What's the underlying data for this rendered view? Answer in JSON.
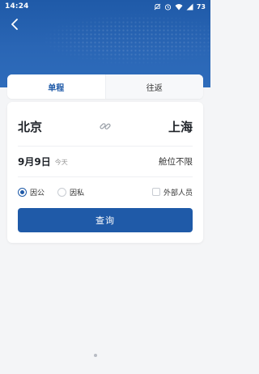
{
  "status_bar": {
    "time": "14:24",
    "battery": "73"
  },
  "tabs": [
    {
      "label": "单程",
      "active": true
    },
    {
      "label": "往返",
      "active": false
    }
  ],
  "route": {
    "from_city": "北京",
    "to_city": "上海"
  },
  "date": {
    "value": "9月9日",
    "note": "今天"
  },
  "cabin": "舱位不限",
  "trip_purpose": [
    {
      "label": "因公",
      "checked": true
    },
    {
      "label": "因私",
      "checked": false
    }
  ],
  "external_staff": {
    "label": "外部人员",
    "checked": false
  },
  "search_button": "查询",
  "colors": {
    "brand": "#1f5aa8",
    "background": "#f4f5f7"
  },
  "icons": [
    "back-arrow",
    "swap-link",
    "mute",
    "alarm",
    "wifi",
    "signal",
    "battery"
  ]
}
